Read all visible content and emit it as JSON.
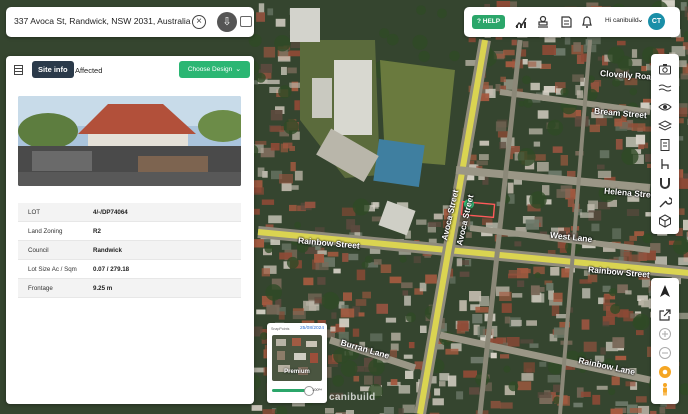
{
  "search": {
    "address": "337 Avoca St, Randwick, NSW 2031, Australia"
  },
  "topbar": {
    "help_label": "HELP",
    "user_label": "Hi canibuild",
    "avatar_initials": "CT"
  },
  "panel": {
    "tabs": [
      "Site info",
      "Affected"
    ],
    "choose_label": "Choose Design",
    "info_rows": [
      {
        "key": "LOT",
        "value": "4/-/DP74064"
      },
      {
        "key": "Land Zoning",
        "value": "R2"
      },
      {
        "key": "Council",
        "value": "Randwick"
      },
      {
        "key": "Lot Size Ac / Sqm",
        "value": "0.07 / 279.18"
      },
      {
        "key": "Frontage",
        "value": "9.25 m"
      }
    ]
  },
  "map": {
    "streets": [
      "Avoca Street",
      "Avoca Street",
      "Rainbow Street",
      "Rainbow Street",
      "West Lane",
      "Rainbow Lane",
      "Helena Street",
      "Bream Street",
      "Clovelly Road",
      "Burran Lane"
    ]
  },
  "imagery": {
    "label": "SnapPoints",
    "date": "25/08/2024",
    "tier": "Premium",
    "opacity": "100%",
    "opacity_value": 1.0
  },
  "watermark": "canibuild",
  "colors": {
    "accent_green": "#2bb673",
    "tab_dark": "#2b3a4a",
    "road_yellow": "#e8e04a",
    "avatar_teal": "#1a8fa8"
  },
  "tools": [
    "camera-icon",
    "waves-icon",
    "eye-icon",
    "layers-icon",
    "document-icon",
    "chair-icon",
    "magnet-icon",
    "wrench-icon",
    "cube-3d-icon"
  ],
  "nav": [
    "north-arrow-icon",
    "share-icon",
    "zoom-in-icon",
    "zoom-out-icon",
    "locate-icon",
    "streetview-person-icon"
  ]
}
